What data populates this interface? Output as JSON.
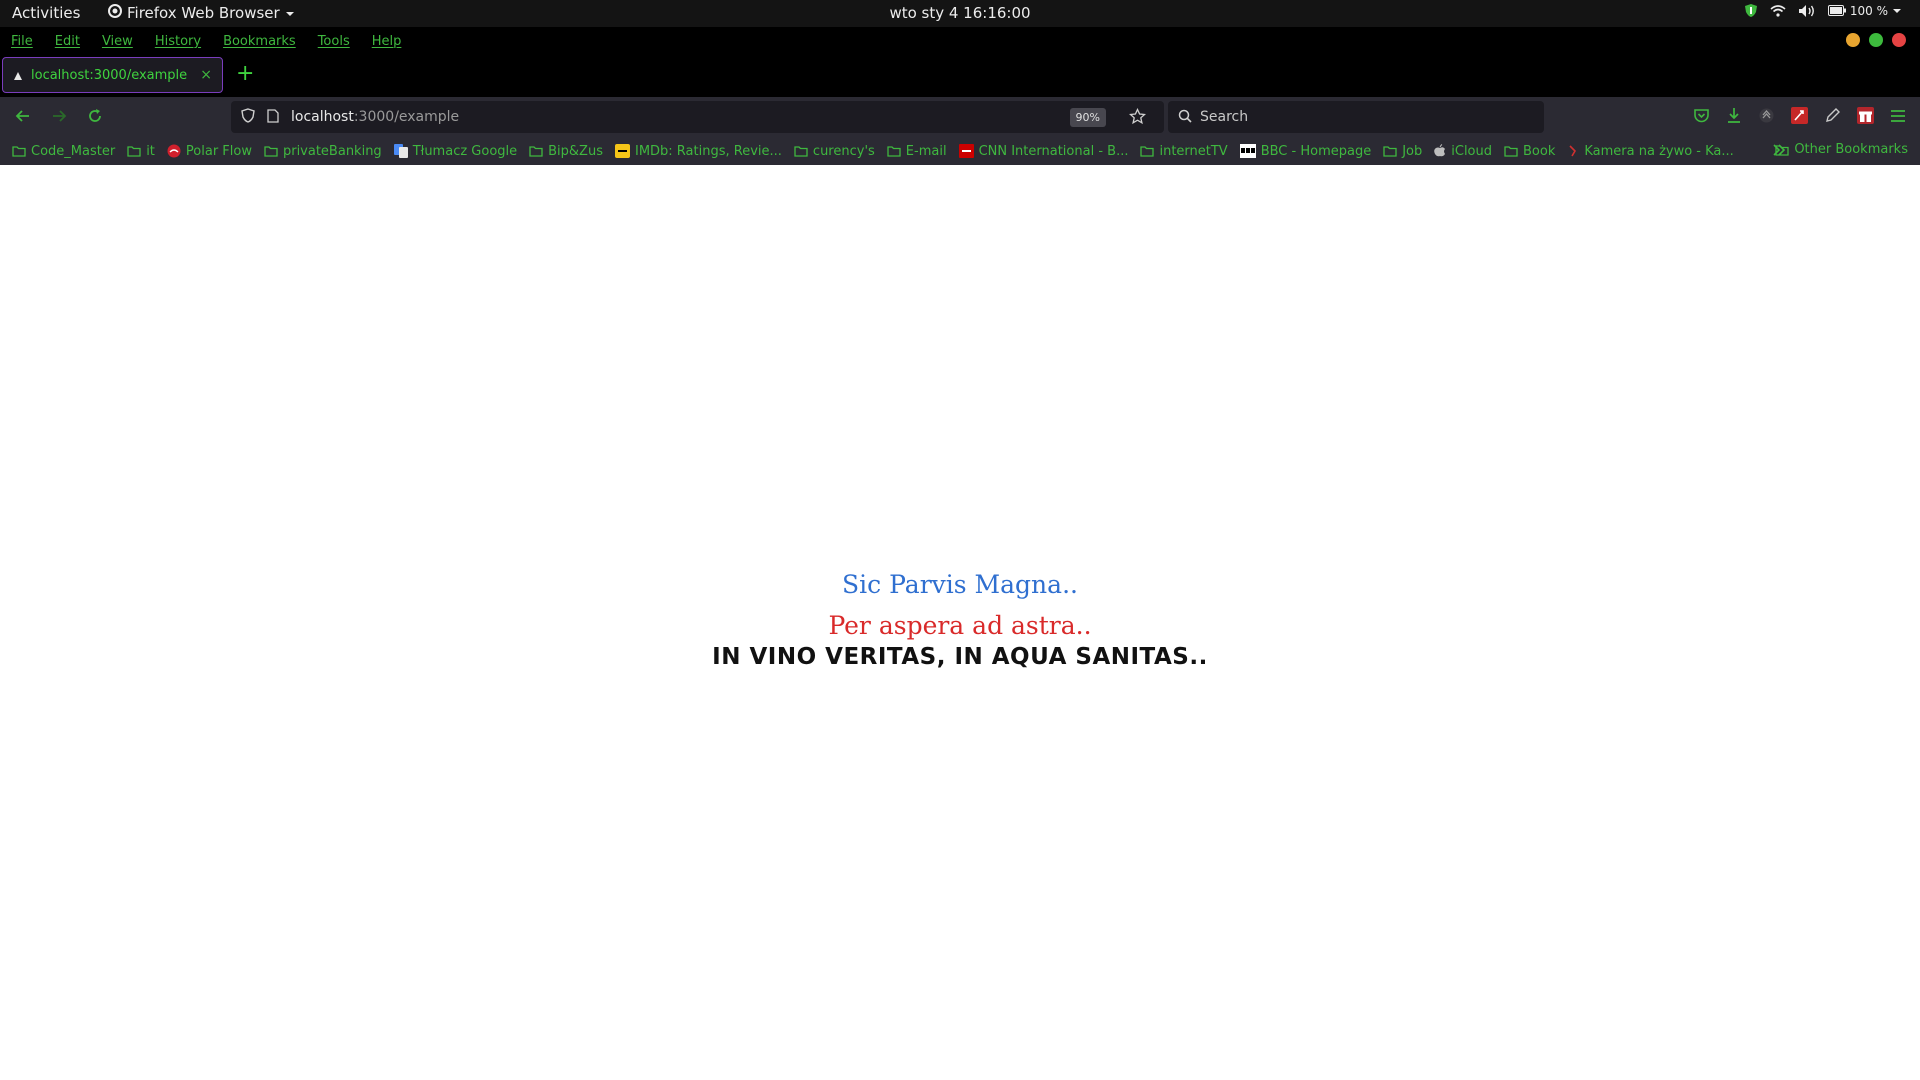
{
  "topbar": {
    "activities": "Activities",
    "app_name": "Firefox Web Browser",
    "clock": "wto sty 4  16:16:00",
    "battery": "100 %"
  },
  "menubar": {
    "items": [
      "File",
      "Edit",
      "View",
      "History",
      "Bookmarks",
      "Tools",
      "Help"
    ]
  },
  "tab": {
    "title": "localhost:3000/example",
    "close": "×",
    "new_tab": "+"
  },
  "urlbar": {
    "host": "localhost",
    "path": ":3000/example",
    "zoom": "90%"
  },
  "search": {
    "placeholder": "Search"
  },
  "bookmarks": {
    "items": [
      {
        "label": "Code_Master",
        "icon": "folder-icon"
      },
      {
        "label": "it",
        "icon": "folder-icon"
      },
      {
        "label": "Polar Flow",
        "icon": "polar-icon"
      },
      {
        "label": "privateBanking",
        "icon": "folder-icon"
      },
      {
        "label": "Tłumacz Google",
        "icon": "translate-icon"
      },
      {
        "label": "Bip&Zus",
        "icon": "folder-icon"
      },
      {
        "label": "IMDb: Ratings, Revie...",
        "icon": "imdb-icon"
      },
      {
        "label": "curency's",
        "icon": "folder-icon"
      },
      {
        "label": "E-mail",
        "icon": "folder-icon"
      },
      {
        "label": "CNN International - B...",
        "icon": "cnn-icon"
      },
      {
        "label": "internetTV",
        "icon": "folder-icon"
      },
      {
        "label": "BBC - Homepage",
        "icon": "bbc-icon"
      },
      {
        "label": "Job",
        "icon": "folder-icon"
      },
      {
        "label": "iCloud",
        "icon": "apple-icon"
      },
      {
        "label": "Book",
        "icon": "folder-icon"
      },
      {
        "label": "Kamera na żywo - Ka...",
        "icon": "camera-icon"
      }
    ],
    "overflow": "»",
    "other": "Other Bookmarks"
  },
  "content": {
    "line1": "Sic Parvis Magna..",
    "line2": "Per aspera ad astra..",
    "line3": "IN VINO VERITAS, IN AQUA SANITAS.."
  },
  "colors": {
    "accent_green": "#3fb83f",
    "line1": "#2f6fd0",
    "line2": "#d92a2a",
    "line3": "#111111"
  }
}
